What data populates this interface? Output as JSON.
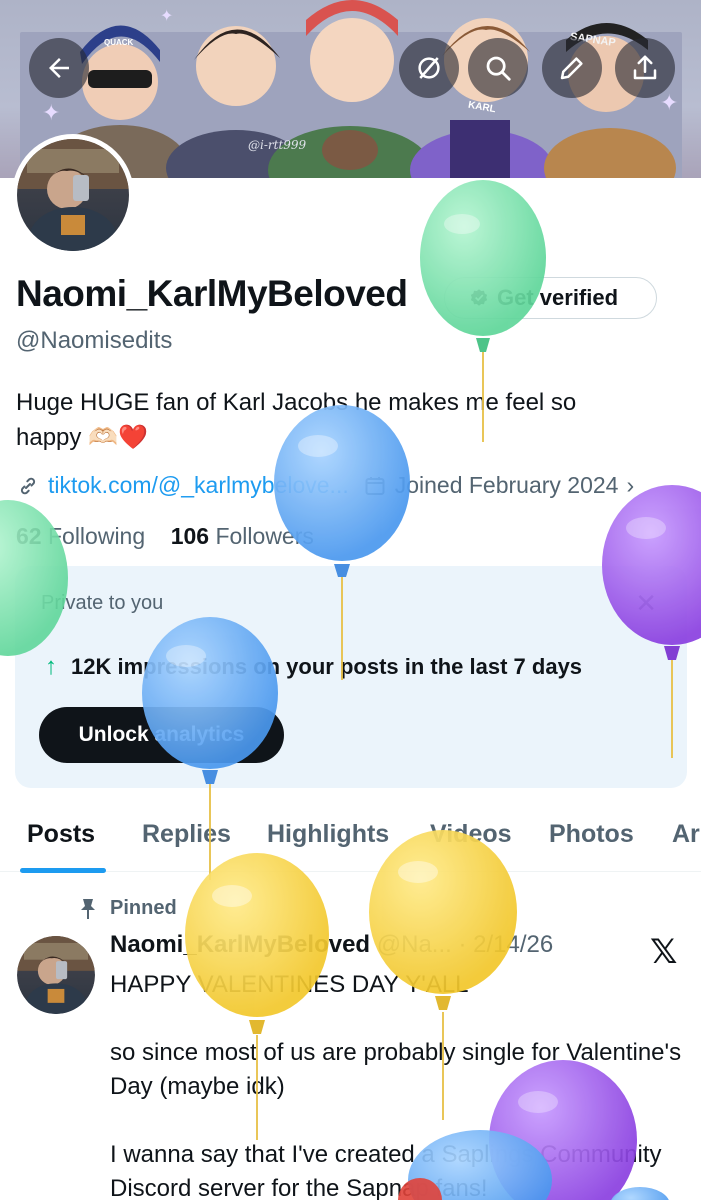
{
  "colors": {
    "accent": "#1d9bf0",
    "text": "#0f1419",
    "muted": "#536471",
    "card_bg": "#ebf4fb",
    "up_arrow": "#00ba7c"
  },
  "banner": {
    "signature": "@i-rtt999",
    "hood_text_1": "SAPNAP",
    "hood_text_2": "KARL",
    "hat_text": "QUACK",
    "buttons": [
      "back-arrow-icon",
      "grok-icon",
      "search-icon",
      "edit-pencil-icon",
      "share-icon"
    ]
  },
  "profile": {
    "display_name": "Naomi_KarlMyBeloved",
    "get_verified_label": "Get verified",
    "handle": "@Naomisedits",
    "bio_line_1": "Huge HUGE fan of Karl Jacobs he makes me feel so",
    "bio_line_2": "happy 🫶🏻❤️",
    "link": "tiktok.com/@_karlmybelove...",
    "joined": "Joined February 2024",
    "following_count": "62",
    "following_label": "Following",
    "followers_count": "106",
    "followers_label": "Followers"
  },
  "analytics_card": {
    "label": "Private to you",
    "close": "✕",
    "stat": "12K impressions on your posts in the last 7 days",
    "button": "Unlock analytics"
  },
  "tabs": [
    "Posts",
    "Replies",
    "Highlights",
    "Videos",
    "Photos",
    "Ar"
  ],
  "pinned_post": {
    "pinned_label": "Pinned",
    "author": "Naomi_KarlMyBeloved",
    "handle_date": "@Na... · 2/14/26",
    "line_1": "HAPPY VALENTINES DAY Y'ALL",
    "line_2": "so since most of us are probably single for Valentine's Day (maybe idk)",
    "line_3": "I wanna say that I've created a Saplings Community Discord server for the Sapnap fans!"
  },
  "balloons": {
    "colors": [
      "green",
      "blue",
      "purple",
      "yellow"
    ]
  }
}
